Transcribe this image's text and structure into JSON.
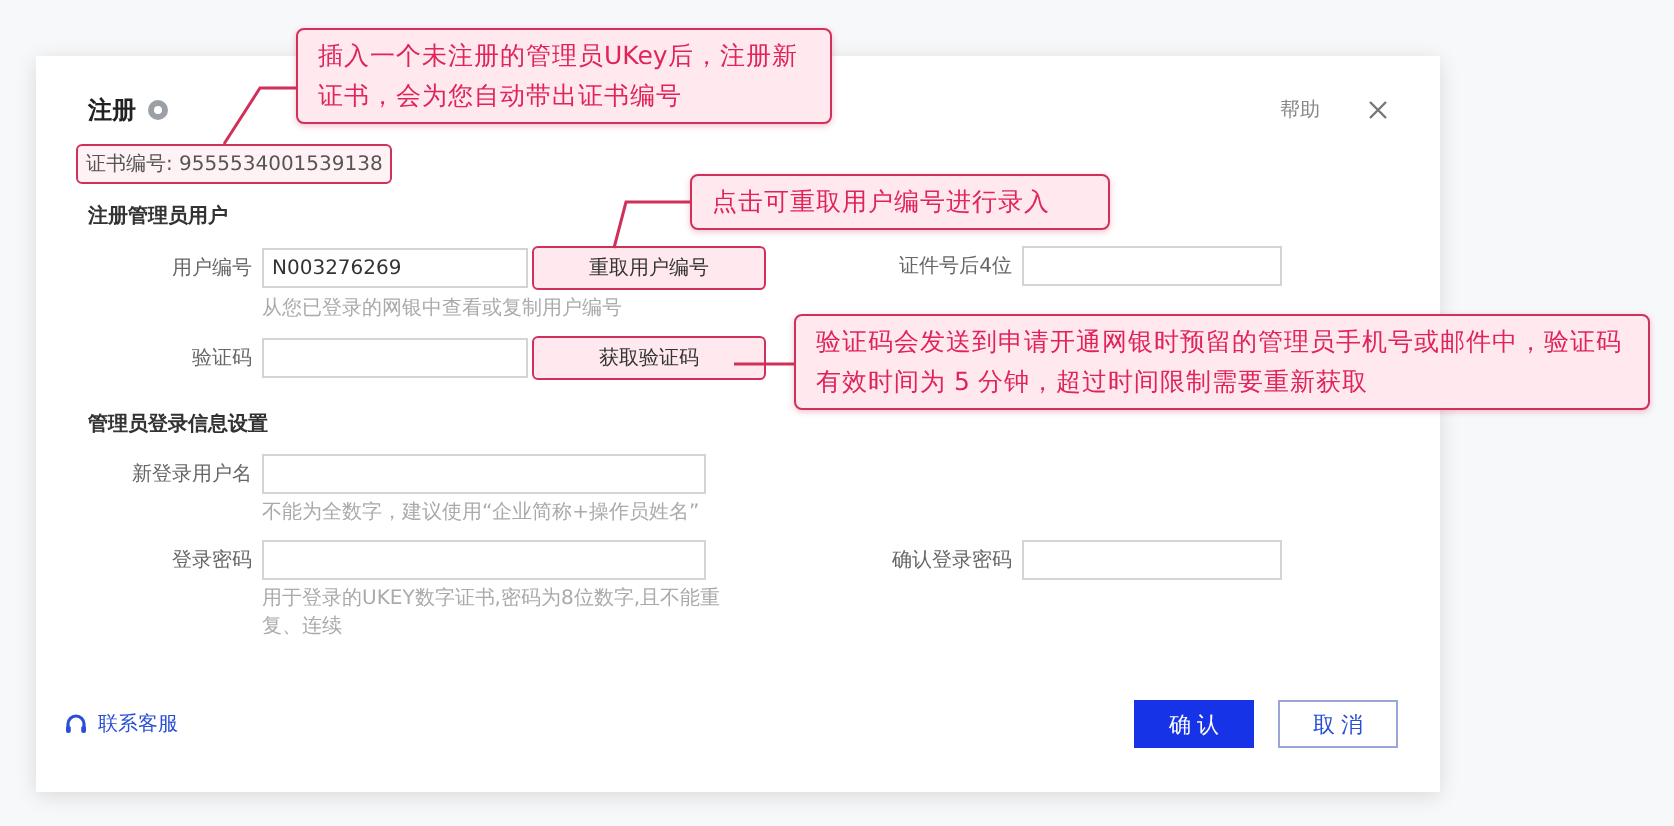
{
  "dialog": {
    "title": "注册",
    "help_link": "帮助"
  },
  "cert_number": {
    "text": "证书编号: 9555534001539138",
    "highlighted": true
  },
  "sections": [
    {
      "title": "注册管理员用户",
      "rows": [
        {
          "fields": [
            {
              "label": "用户编号",
              "value": "N003276269",
              "button": {
                "label": "重取用户编号",
                "highlighted": true
              },
              "hint": "从您已登录的网银中查看或复制用户编号"
            },
            {
              "label": "证件号后4位"
            }
          ]
        },
        {
          "fields": [
            {
              "label": "验证码",
              "button": {
                "label": "获取验证码",
                "highlighted": true
              }
            }
          ]
        }
      ]
    },
    {
      "title": "管理员登录信息设置",
      "rows": [
        {
          "fields": [
            {
              "label": "新登录用户名",
              "hint": "不能为全数字，建议使用“企业简称+操作员姓名”"
            }
          ]
        },
        {
          "fields": [
            {
              "label": "登录密码",
              "hint": "用于登录的UKEY数字证书,密码为8位数字,且不能重复、连续"
            },
            {
              "label": "确认登录密码"
            }
          ]
        }
      ]
    }
  ],
  "contact_link": "联系客服",
  "buttons": [
    {
      "label": "确 认",
      "kind": "primary"
    },
    {
      "label": "取 消",
      "kind": "secondary"
    }
  ],
  "callouts": [
    "插入一个未注册的管理员UKey后，注册新证书，会为您自动带出证书编号",
    "点击可重取用户编号进行录入",
    "验证码会发送到申请开通网银时预留的管理员手机号或邮件中，验证码有效时间为 5 分钟，超过时间限制需要重新获取"
  ]
}
